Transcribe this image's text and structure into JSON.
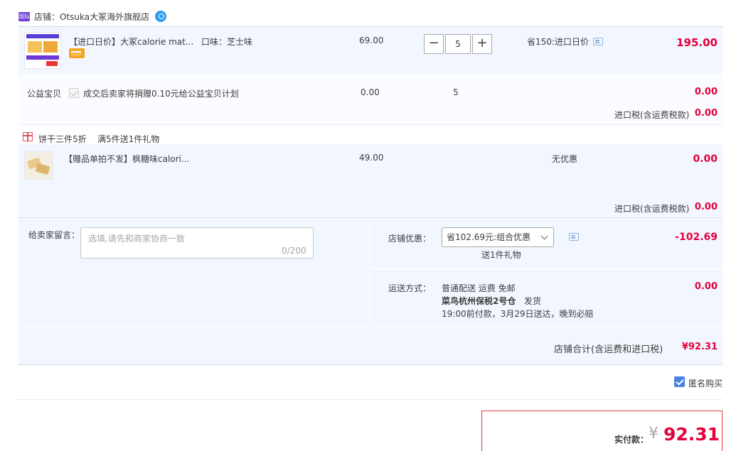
{
  "shop": {
    "badge": "国际",
    "name": "店铺：Otsuka大冢海外旗舰店"
  },
  "item1": {
    "title": "【进口日价】大冢calorie mat...",
    "sku": "口味：芝士味",
    "price": "69.00",
    "quantity": "5",
    "promo": "省150:进口日价",
    "subtotal": "195.00"
  },
  "stepper": {
    "minus": "−",
    "plus": "+"
  },
  "charity": {
    "label": "公益宝贝",
    "text": "成交后卖家将捐赠0.10元给公益宝贝计划",
    "price": "0.00",
    "quantity": "5",
    "subtotal": "0.00"
  },
  "tax1": {
    "label": "进口税(含运费税款)",
    "value": "0.00"
  },
  "gift_promo": {
    "tag": "饼干三件5折",
    "rule": "满5件送1件礼物"
  },
  "item2": {
    "title": "【赠品单拍不发】枫糖味calori...",
    "price": "49.00",
    "promo": "无优惠",
    "subtotal": "0.00"
  },
  "tax2": {
    "label": "进口税(含运费税款)",
    "value": "0.00"
  },
  "note": {
    "label": "给卖家留言：",
    "placeholder": "选填,请先和商家协商一致",
    "count": "0/200"
  },
  "coupon": {
    "label": "店铺优惠：",
    "selected": "省102.69元:组合优惠",
    "gift": "送1件礼物",
    "value": "-102.69"
  },
  "shipping": {
    "label": "运送方式：",
    "line1": "普通配送 运费 免邮",
    "warehouse": "菜鸟杭州保税2号仓",
    "dispatch": "发货",
    "line3": "19:00前付款，3月29日送达，晚到必赔",
    "value": "0.00"
  },
  "shop_total": {
    "label": "店铺合计(含运费和进口税)",
    "value": "¥92.31"
  },
  "anonymous": {
    "label": "匿名购买",
    "checked": true
  },
  "payment": {
    "label": "实付款：",
    "currency": "¥",
    "value": "92.31"
  },
  "colors": {
    "accent_red": "#e4003a",
    "light_blue": "#f2f7ff",
    "check_blue": "#4b82e4"
  }
}
